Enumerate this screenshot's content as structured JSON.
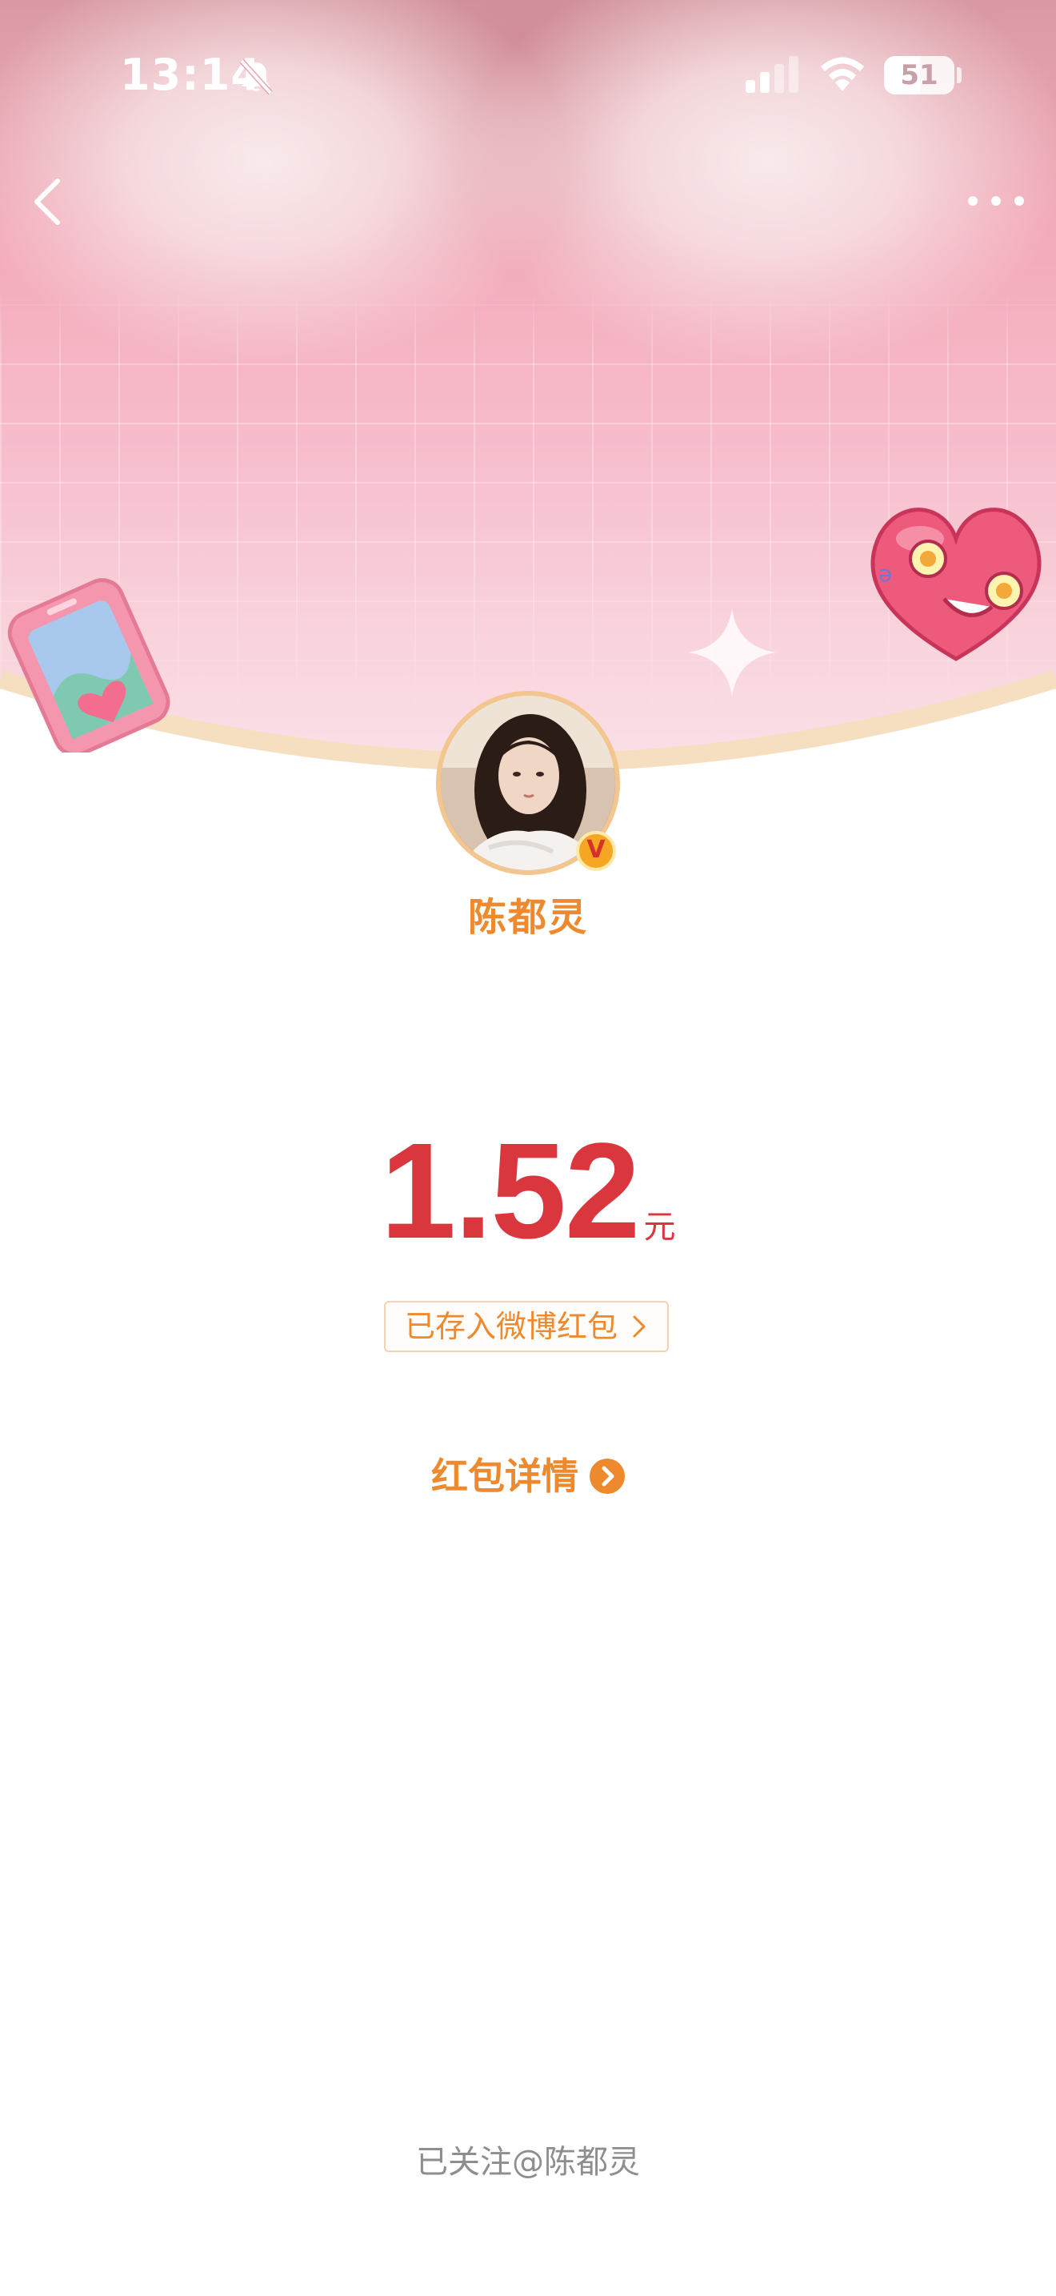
{
  "status_bar": {
    "time": "13:14",
    "battery_level": "51",
    "battery_fraction": 0.51
  },
  "nav": {
    "back_icon": "chevron-left-icon",
    "more_icon": "more-dots-icon"
  },
  "profile": {
    "name": "陈都灵",
    "verified_badge": "V"
  },
  "red_packet": {
    "amount": "1.52",
    "unit": "元",
    "saved_label": "已存入微博红包",
    "details_label": "红包详情"
  },
  "footer": {
    "follow_text": "已关注@陈都灵"
  },
  "colors": {
    "accent_orange": "#ee8a2d",
    "amount_red": "#d9363e",
    "header_pink": "#f3a9b9"
  }
}
